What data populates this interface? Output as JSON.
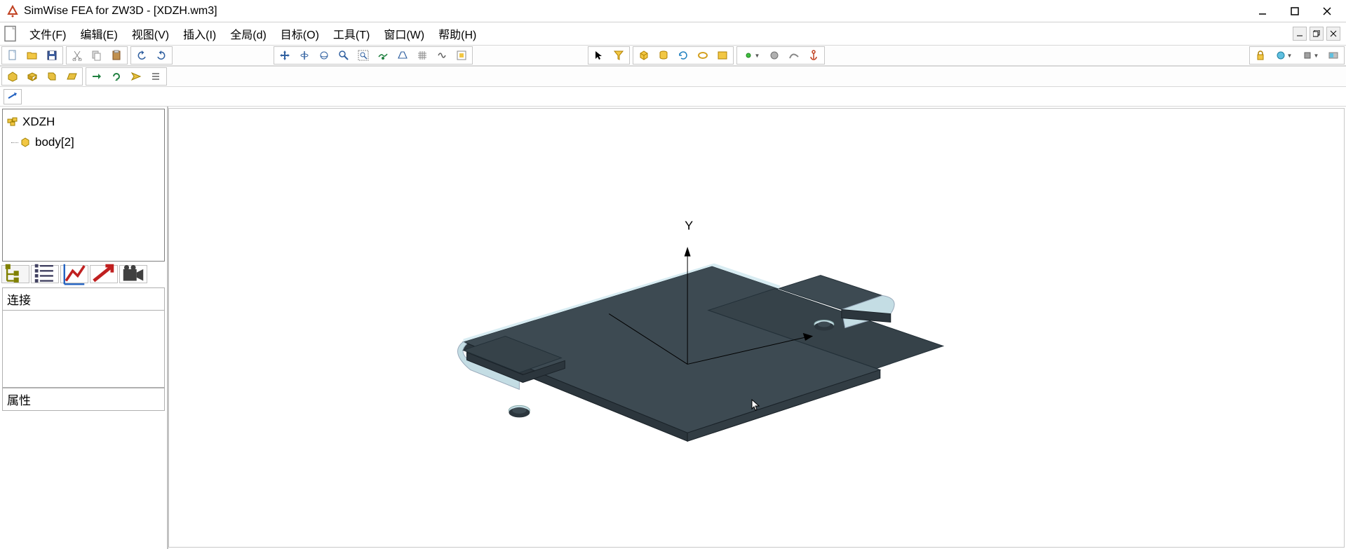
{
  "app": {
    "title": "SimWise FEA for ZW3D - [XDZH.wm3]"
  },
  "menu": {
    "file": "文件(F)",
    "edit": "编辑(E)",
    "view": "视图(V)",
    "insert": "插入(I)",
    "global": "全局(d)",
    "target": "目标(O)",
    "tools": "工具(T)",
    "window": "窗口(W)",
    "help": "帮助(H)"
  },
  "tree": {
    "root": "XDZH",
    "child": "body[2]"
  },
  "panels": {
    "connect": "连接",
    "properties": "属性"
  },
  "axis": {
    "y_label": "Y"
  }
}
